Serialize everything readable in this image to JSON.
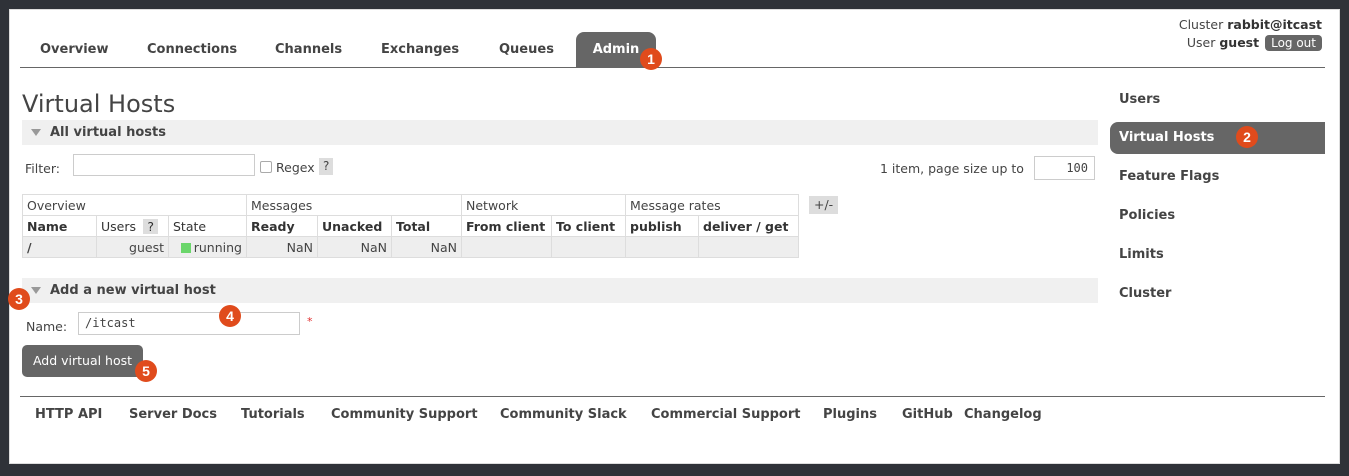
{
  "nav": {
    "tabs": [
      "Overview",
      "Connections",
      "Channels",
      "Exchanges",
      "Queues",
      "Admin"
    ],
    "active": "Admin"
  },
  "cluster": {
    "cluster_label": "Cluster",
    "cluster_name": "rabbit@itcast",
    "user_label": "User",
    "user_name": "guest",
    "logout": "Log out"
  },
  "page_title": "Virtual Hosts",
  "all_vhosts": {
    "heading": "All virtual hosts",
    "filter_label": "Filter:",
    "filter_value": "",
    "regex_label": "Regex",
    "help": "?",
    "page_size_label": "1 item, page size up to",
    "page_size": "100",
    "toggle_columns": "+/-",
    "groups": [
      "Overview",
      "Messages",
      "Network",
      "Message rates"
    ],
    "columns": [
      "Name",
      "Users",
      "State",
      "Ready",
      "Unacked",
      "Total",
      "From client",
      "To client",
      "publish",
      "deliver / get"
    ],
    "rows": [
      {
        "name": "/",
        "users": "guest",
        "state": "running",
        "ready": "NaN",
        "unacked": "NaN",
        "total": "NaN",
        "from_client": "",
        "to_client": "",
        "publish": "",
        "deliver_get": ""
      }
    ]
  },
  "add_vhost": {
    "heading": "Add a new virtual host",
    "name_label": "Name:",
    "name_value": "/itcast",
    "required": "*",
    "button": "Add virtual host"
  },
  "sidebar": {
    "items": [
      "Users",
      "Virtual Hosts",
      "Feature Flags",
      "Policies",
      "Limits",
      "Cluster"
    ],
    "active": "Virtual Hosts"
  },
  "footer": {
    "links": [
      "HTTP API",
      "Server Docs",
      "Tutorials",
      "Community Support",
      "Community Slack",
      "Commercial Support",
      "Plugins",
      "GitHub",
      "Changelog"
    ]
  },
  "annotations": [
    "1",
    "2",
    "3",
    "4",
    "5"
  ],
  "colors": {
    "accent": "#666666",
    "badge": "#e04b1c",
    "running": "#6bd66b",
    "background": "#2f3238"
  }
}
